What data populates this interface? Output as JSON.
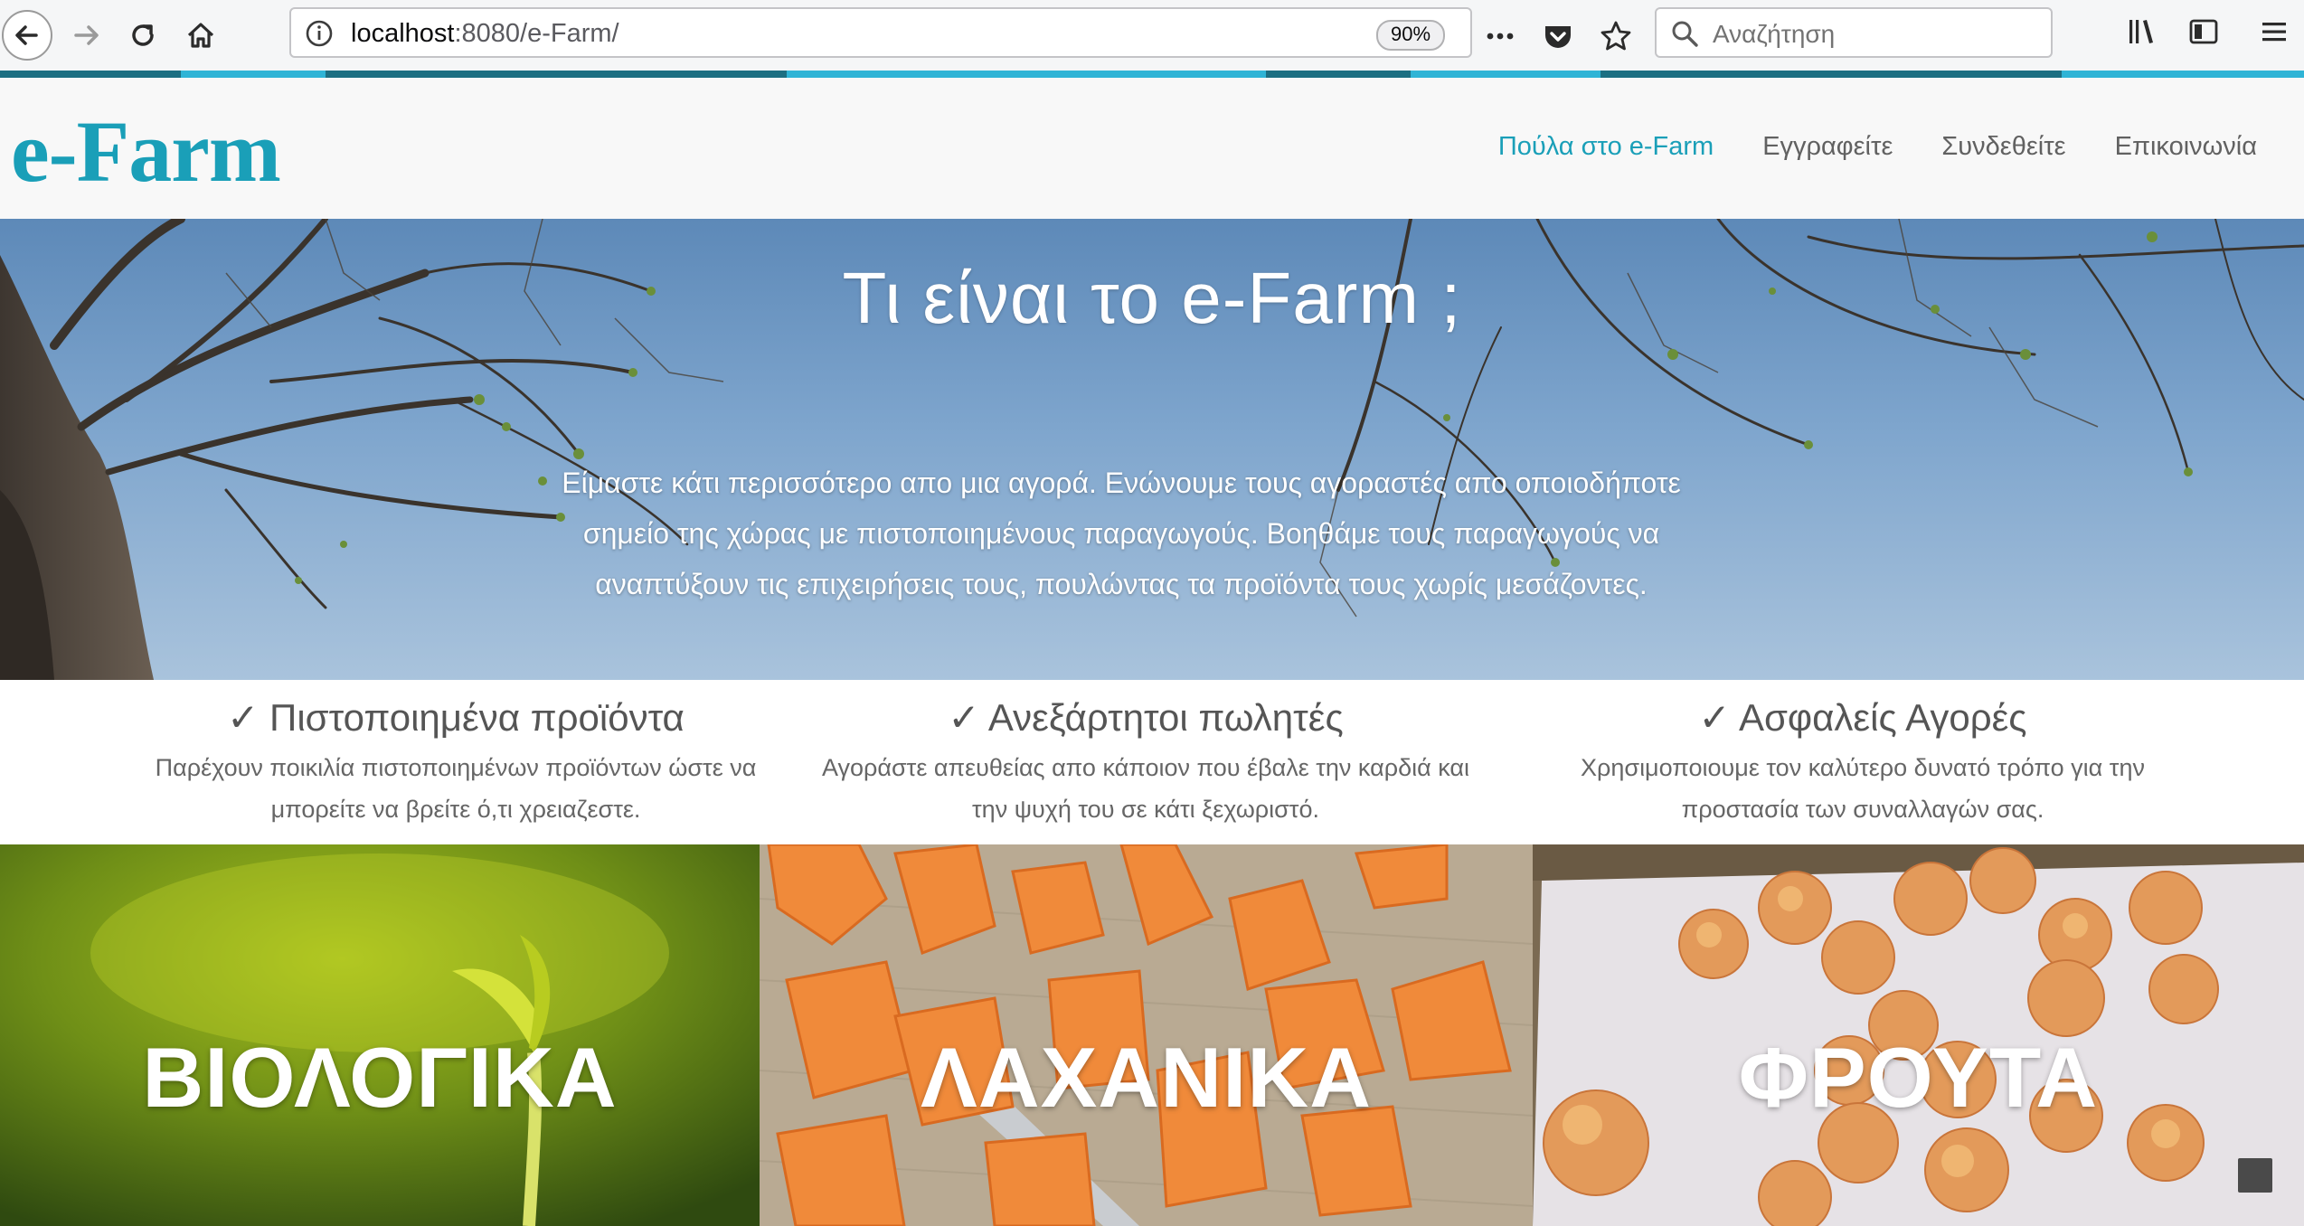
{
  "browser": {
    "url_host": "localhost",
    "url_rest": ":8080/e-Farm/",
    "zoom": "90%",
    "search_placeholder": "Αναζήτηση"
  },
  "site": {
    "logo": "e-Farm",
    "nav": [
      {
        "label": "Πούλα στο e-Farm",
        "active": true
      },
      {
        "label": "Εγγραφείτε",
        "active": false
      },
      {
        "label": "Συνδεθείτε",
        "active": false
      },
      {
        "label": "Επικοινωνία",
        "active": false
      }
    ]
  },
  "hero": {
    "title": "Τι είναι το e-Farm ;",
    "text": "Είμαστε κάτι περισσότερο απο μια αγορά. Ενώνουμε τους αγοραστές απο οποιοδήποτε σημείο της χώρας με πιστοποιημένους παραγωγούς. Βοηθάμε τους παραγωγούς να αναπτύξουν τις επιχειρήσεις τους, πουλώντας τα προϊόντα τους χωρίς μεσάζοντες."
  },
  "features": [
    {
      "title": "✓ Πιστοποιημένα προϊόντα",
      "text": "Παρέχουν ποικιλία πιστοποιημένων προϊόντων ώστε να μπορείτε να βρείτε ό,τι χρειαζεστε."
    },
    {
      "title": "✓ Ανεξάρτητοι πωλητές",
      "text": "Αγοράστε απευθείας απο κάποιον που έβαλε την καρδιά και την ψυχή του σε κάτι ξεχωριστό."
    },
    {
      "title": "✓ Ασφαλείς Αγορές",
      "text": "Χρησιμοποιουμε τον καλύτερο δυνατό τρόπο για την προστασία των συναλλαγών σας."
    }
  ],
  "categories": [
    {
      "label": "ΒΙΟΛΟΓΙΚΑ"
    },
    {
      "label": "ΛΑΧΑΝΙΚΑ"
    },
    {
      "label": "ΦΡΟΥΤΑ"
    }
  ],
  "colors": {
    "brand": "#1a9fb8",
    "nav_text": "#616161"
  }
}
